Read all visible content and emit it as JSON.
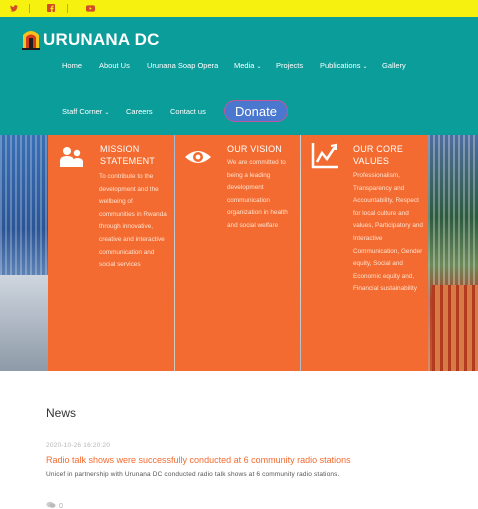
{
  "social": {
    "icons": [
      "twitter-icon",
      "facebook-icon",
      "youtube-icon"
    ],
    "color": "#d24a2a"
  },
  "brand": {
    "name": "URUNANA DC",
    "header_color": "#0a9d9a",
    "topbar_color": "#f7f10f",
    "accent": "#f36b30"
  },
  "nav": {
    "home": "Home",
    "about": "About Us",
    "soap": "Urunana Soap Opera",
    "media": "Media",
    "projects": "Projects",
    "publications": "Publications",
    "gallery": "Gallery",
    "staff": "Staff Corner",
    "careers": "Careers",
    "contact": "Contact us",
    "donate": "Donate"
  },
  "panels": {
    "mission": {
      "title": "MISSION STATEMENT",
      "text": "To contribute to the development and the wellbeing of communities in Rwanda through innovative, creative and interactive communication and social services",
      "icon": "people-icon"
    },
    "vision": {
      "title": "OUR VISION",
      "text": "We are committed to being a leading development communication organization in health and social welfare",
      "icon": "eye-icon"
    },
    "values": {
      "title": "OUR CORE VALUES",
      "text": "Professionalism, Transparency and Accountability, Respect for local culture and values, Participatory and Interactive Communication, Gender equity, Social and Economic equity and, Financial sustainability",
      "icon": "chart-icon"
    }
  },
  "news": {
    "heading": "News",
    "date": "2020-10-26 16:20:20",
    "headline": "Radio talk shows were successfully conducted at 6 community radio stations",
    "excerpt": "Unicef in partnership with Urunana DC conducted radio talk shows at 6 community radio stations.",
    "comments": "0"
  }
}
